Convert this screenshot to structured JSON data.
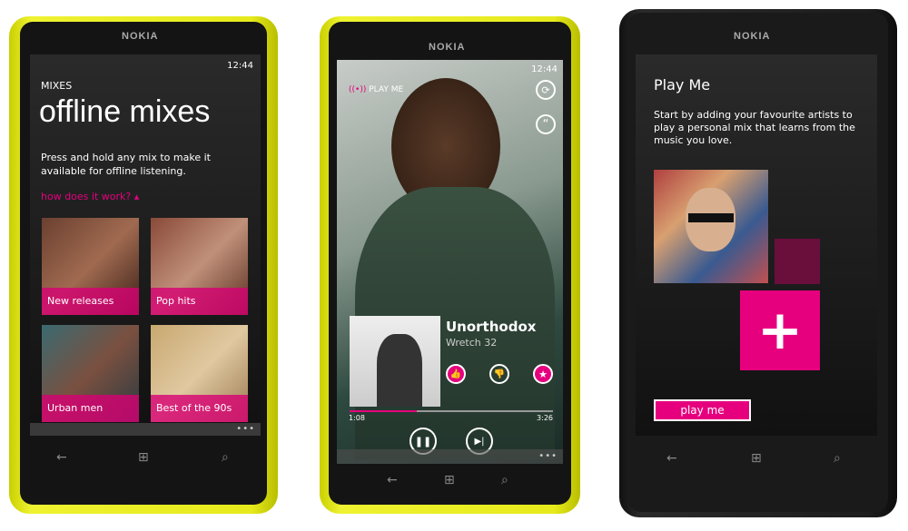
{
  "brand": "NOKIA",
  "phone1": {
    "time": "12:44",
    "section": "MIXES",
    "title": "offline mixes",
    "description": "Press and hold any mix to make it available for offline listening.",
    "help_link": "how does it work? ▴",
    "tiles": [
      {
        "label": "New releases"
      },
      {
        "label": "Pop hits"
      },
      {
        "label": "Urban men"
      },
      {
        "label": "Best of the 90s"
      }
    ],
    "more": "•••"
  },
  "phone2": {
    "time": "12:44",
    "app_label": "PLAY ME",
    "track": "Unorthodox",
    "artist": "Wretch 32",
    "elapsed": "1:08",
    "duration": "3:26",
    "progress": 0.33,
    "more": "•••"
  },
  "phone3": {
    "title": "Play Me",
    "description": "Start by adding your favourite artists to play a personal mix that learns from the music you love.",
    "button": "play me"
  },
  "accent": "#e6007e",
  "nav": {
    "back": "←",
    "start": "⊞",
    "search": "⌕"
  }
}
